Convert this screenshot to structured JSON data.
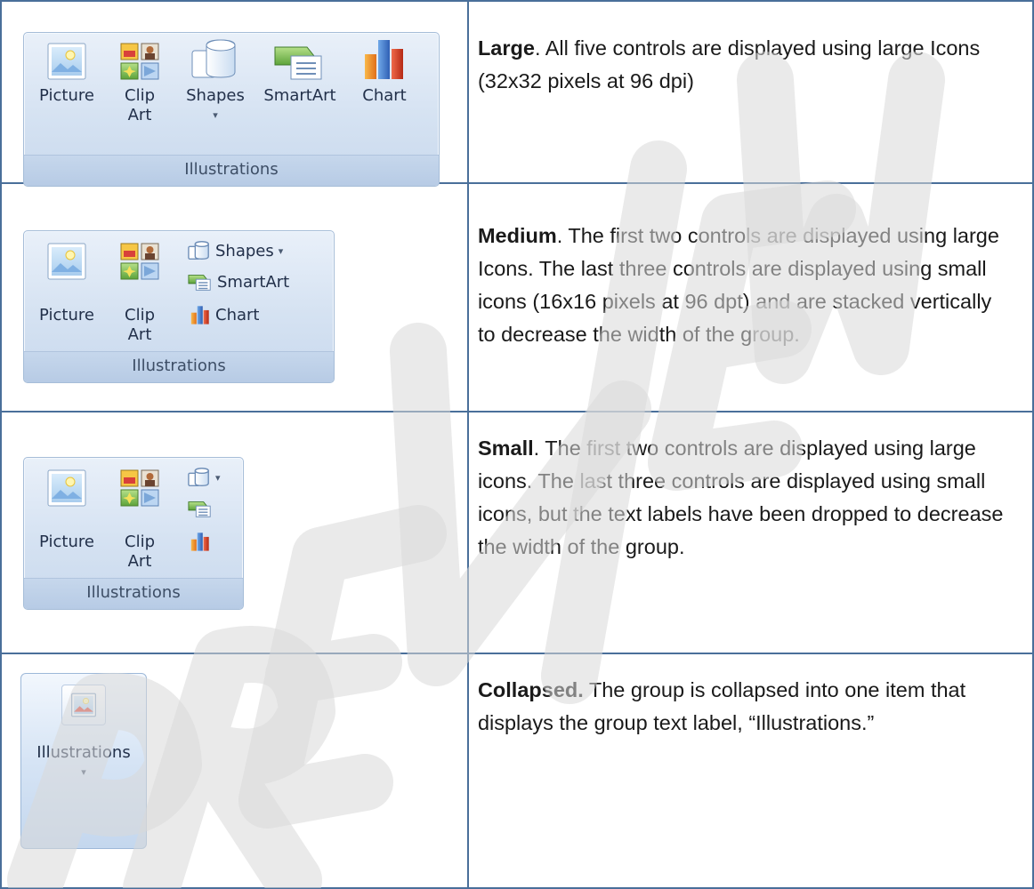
{
  "rows": [
    {
      "title": "Large",
      "title_suffix": ".",
      "text": "  All five controls are displayed using large Icons (32x32 pixels at 96 dpi)"
    },
    {
      "title": "Medium",
      "title_suffix": ".",
      "text": "  The first two controls are displayed using large Icons.  The last three controls are displayed using small icons (16x16 pixels at 96 dpt) and are stacked vertically to decrease the width of the group."
    },
    {
      "title": "Small",
      "title_suffix": ".",
      "text": "  The first two controls are displayed using large icons.  The last three controls are displayed using small icons, but the text labels have been dropped to decrease the width of the group."
    },
    {
      "title": "Collapsed.",
      "title_suffix": "",
      "text": "  The group is collapsed into one item that displays the group text label, “Illustrations.”"
    }
  ],
  "ribbon": {
    "group_label": "Illustrations",
    "controls": {
      "picture": "Picture",
      "clip_line1": "Clip",
      "clip_line2": "Art",
      "shapes": "Shapes",
      "smartart": "SmartArt",
      "chart": "Chart"
    },
    "dropdown_arrow": "▾"
  },
  "icons": {
    "picture": "picture-icon",
    "clip_art": "clip-art-icon",
    "shapes": "shapes-icon",
    "smartart": "smartart-icon",
    "chart": "chart-icon"
  },
  "watermark": "PREVIEW"
}
